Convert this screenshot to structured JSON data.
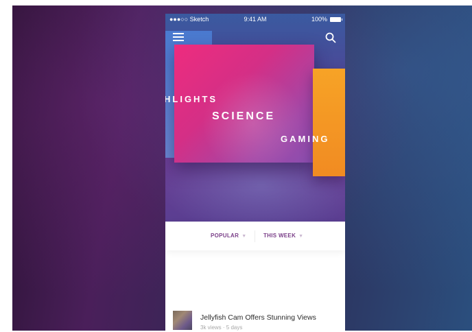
{
  "status_bar": {
    "carrier": "●●●○○ Sketch",
    "time": "9:41 AM",
    "battery": "100%"
  },
  "header": {
    "menu_icon": "hamburger-menu-icon",
    "search_icon": "search-icon"
  },
  "categories": [
    {
      "label": "HLIGHTS"
    },
    {
      "label": "SCIENCE"
    },
    {
      "label": "GAMING"
    }
  ],
  "filters": {
    "popular": "POPULAR",
    "this_week": "THIS WEEK"
  },
  "article": {
    "title": "Jellyfish Cam Offers Stunning Views",
    "meta": "3k views · 5 days"
  },
  "colors": {
    "accent": "#7a3e88",
    "science_card": "#ee2c7e",
    "gaming_card": "#f7a326",
    "highlights_card": "#4a7ad0"
  }
}
